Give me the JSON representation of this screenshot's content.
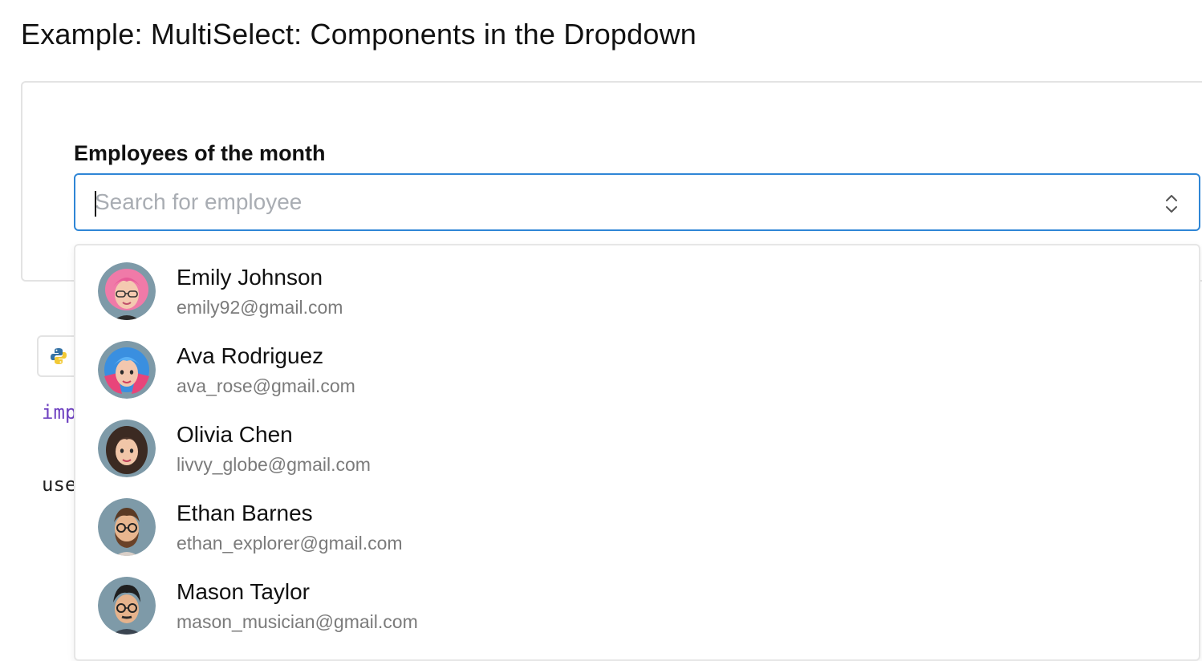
{
  "page": {
    "title": "Example: MultiSelect: Components in the Dropdown"
  },
  "multiselect": {
    "label": "Employees of the month",
    "placeholder": "Search for employee",
    "value": "",
    "toggle_icon": "chevron-up-down-icon",
    "accent_color": "#2f86d6"
  },
  "code_preview": {
    "language_icon": "python-icon",
    "line_1": "imp",
    "line_2": "use"
  },
  "employees": [
    {
      "name": "Emily Johnson",
      "email": "emily92@gmail.com",
      "avatar": "avatar-pink-hair-glasses"
    },
    {
      "name": "Ava Rodriguez",
      "email": "ava_rose@gmail.com",
      "avatar": "avatar-blue-pink-hair"
    },
    {
      "name": "Olivia Chen",
      "email": "livvy_globe@gmail.com",
      "avatar": "avatar-long-dark-hair"
    },
    {
      "name": "Ethan Barnes",
      "email": "ethan_explorer@gmail.com",
      "avatar": "avatar-beard-glasses"
    },
    {
      "name": "Mason Taylor",
      "email": "mason_musician@gmail.com",
      "avatar": "avatar-glasses-dark-hair"
    }
  ]
}
